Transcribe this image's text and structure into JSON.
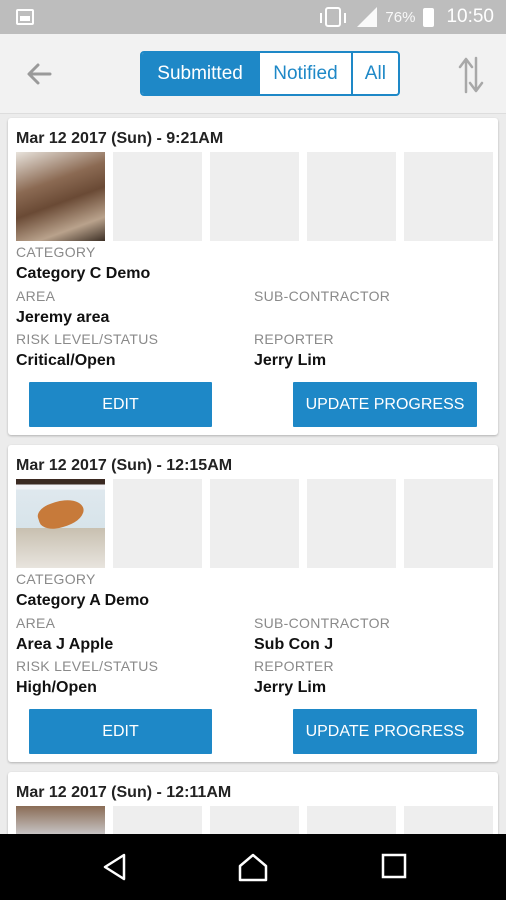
{
  "status_bar": {
    "battery": "76%",
    "time": "10:50",
    "icons": [
      "gallery-icon",
      "vibrate-icon",
      "signal-icon",
      "battery-icon"
    ]
  },
  "toolbar": {
    "back_icon": "arrow-left-icon",
    "segments": [
      "Submitted",
      "Notified",
      "All"
    ],
    "selected_segment": "Submitted",
    "sort_icon": "sort-arrows-icon"
  },
  "labels": {
    "category": "CATEGORY",
    "area": "AREA",
    "sub_contractor": "SUB-CONTRACTOR",
    "risk": "RISK LEVEL/STATUS",
    "reporter": "REPORTER",
    "edit": "EDIT",
    "update": "UPDATE PROGRESS"
  },
  "reports": [
    {
      "date": "Mar 12 2017 (Sun) - 9:21AM",
      "category": "Category C Demo",
      "area": "Jeremy area",
      "sub_contractor": "",
      "risk": "Critical/Open",
      "reporter": "Jerry Lim"
    },
    {
      "date": "Mar 12 2017 (Sun) - 12:15AM",
      "category": "Category A Demo",
      "area": "Area J Apple",
      "sub_contractor": "Sub Con J",
      "risk": "High/Open",
      "reporter": "Jerry Lim"
    },
    {
      "date": "Mar 12 2017 (Sun) - 12:11AM"
    }
  ],
  "colors": {
    "accent": "#1e88c7",
    "status_bar": "#bdbdbd",
    "background": "#ececec"
  }
}
